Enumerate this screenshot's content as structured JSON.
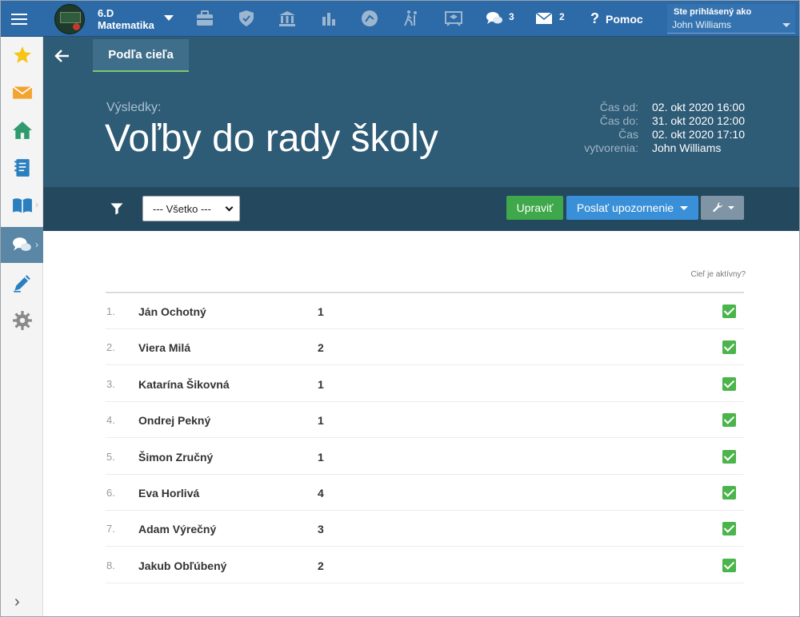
{
  "topbar": {
    "class_line1": "6.D",
    "class_line2": "Matematika",
    "messages_count": "3",
    "mail_count": "2",
    "help_label": "Pomoc",
    "user_label": "Ste prihlásený ako",
    "user_name": "John Williams"
  },
  "header": {
    "tab_label": "Podľa cieľa",
    "subtitle": "Výsledky:",
    "title": "Voľby do rady školy",
    "meta": {
      "from_label": "Čas od:",
      "from_value": "02. okt 2020 16:00",
      "to_label": "Čas do:",
      "to_value": "31. okt 2020 12:00",
      "created_label_1": "Čas",
      "created_label_2": "vytvorenia:",
      "created_value": "02. okt 2020 17:10",
      "author_value": "John Williams"
    }
  },
  "toolbar": {
    "filter_value": "--- Všetko ---",
    "edit_label": "Upraviť",
    "notify_label": "Poslať upozornenie"
  },
  "table": {
    "active_header": "Cieľ je aktívny?",
    "rows": [
      {
        "num": "1.",
        "name": "Ján Ochotný",
        "value": "1",
        "active": true
      },
      {
        "num": "2.",
        "name": "Viera Milá",
        "value": "2",
        "active": true
      },
      {
        "num": "3.",
        "name": "Katarína Šikovná",
        "value": "1",
        "active": true
      },
      {
        "num": "4.",
        "name": "Ondrej Pekný",
        "value": "1",
        "active": true
      },
      {
        "num": "5.",
        "name": "Šimon Zručný",
        "value": "1",
        "active": true
      },
      {
        "num": "6.",
        "name": "Eva Horlivá",
        "value": "4",
        "active": true
      },
      {
        "num": "7.",
        "name": "Adam Výrečný",
        "value": "3",
        "active": true
      },
      {
        "num": "8.",
        "name": "Jakub Obľúbený",
        "value": "2",
        "active": true
      }
    ]
  },
  "colors": {
    "topbar": "#2d6aa8",
    "hero": "#2e5b76",
    "toolbar": "#24495f",
    "edit_button": "#3ea84a",
    "notify_button": "#3a90d8",
    "check": "#4bb44a"
  },
  "icons": [
    "menu-icon",
    "briefcase-icon",
    "shield-icon",
    "bank-icon",
    "bar-chart-icon",
    "ball-icon",
    "walking-icon",
    "presentation-icon",
    "chat-icon",
    "mail-icon",
    "star-icon",
    "envelope-icon",
    "home-icon",
    "notebook-icon",
    "book-icon",
    "comments-icon",
    "pencil-icon",
    "gear-icon",
    "filter-icon",
    "wrench-icon",
    "back-arrow-icon",
    "checkbox-icon"
  ]
}
